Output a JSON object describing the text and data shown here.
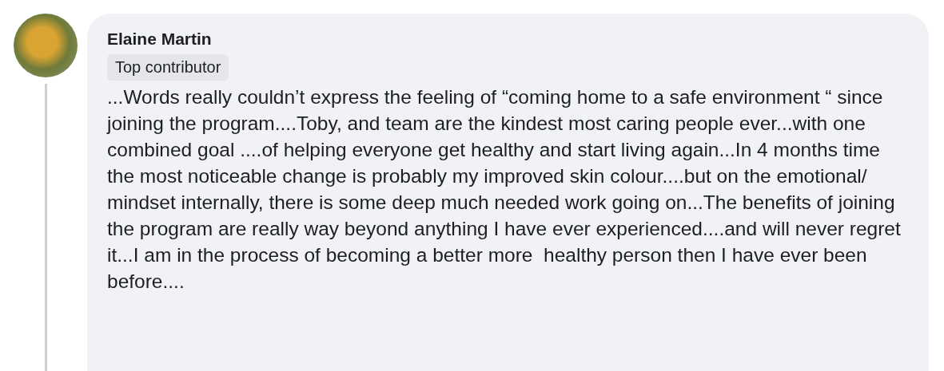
{
  "comment": {
    "author": "Elaine Martin",
    "badge": "Top contributor",
    "text": "...Words really couldn’t express the feeling of “coming home to a safe environment “ since joining the program....Toby, and team are the kindest most caring people ever...with one combined goal ....of helping everyone get healthy and start living again...In 4 months time   the most noticeable change is probably my improved skin colour....but on the emotional/ mindset internally, there is some deep much needed work going on...The benefits of joining the program are really way beyond anything I have ever experienced....and will never regret it...I am in the process of becoming a better more  healthy person then I have ever been before...."
  }
}
